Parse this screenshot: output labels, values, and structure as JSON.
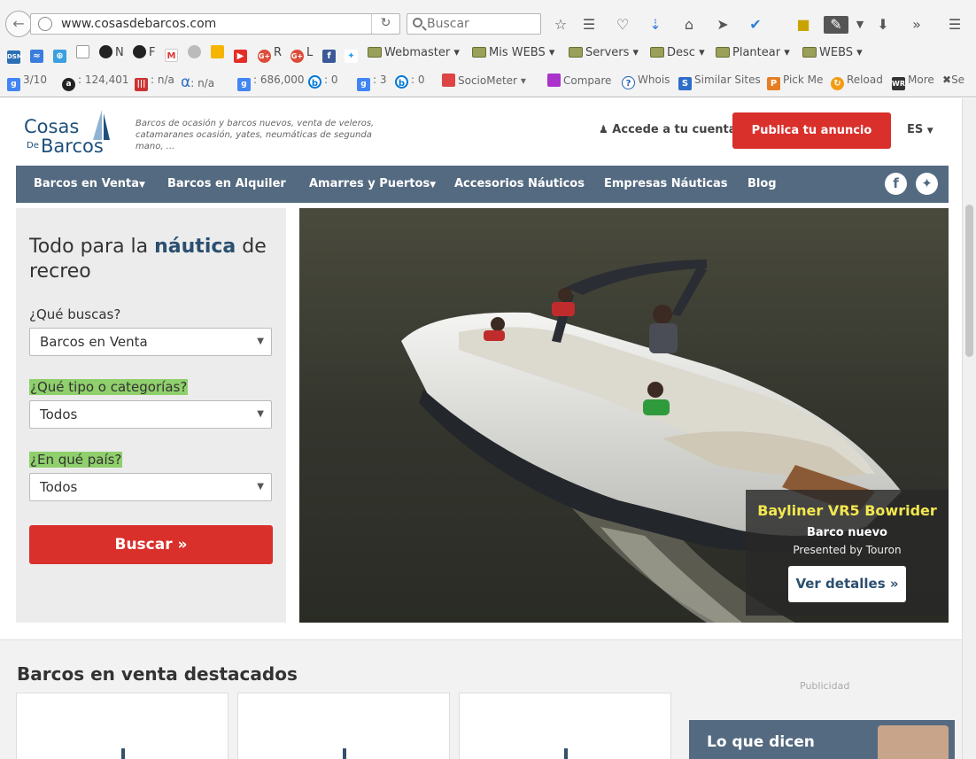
{
  "browser": {
    "url": "www.cosasdebarcos.com",
    "search_placeholder": "Buscar",
    "bookmarks": [
      {
        "label": "N",
        "type": "site"
      },
      {
        "label": "F",
        "type": "site"
      },
      {
        "label": "R",
        "type": "site"
      },
      {
        "label": "L",
        "type": "site"
      },
      {
        "label": "Webmaster",
        "type": "folder"
      },
      {
        "label": "Mis WEBS",
        "type": "folder"
      },
      {
        "label": "Servers",
        "type": "folder"
      },
      {
        "label": "Desc",
        "type": "folder"
      },
      {
        "label": "Plantear",
        "type": "folder"
      },
      {
        "label": "WEBS",
        "type": "folder"
      }
    ],
    "seo_stats": {
      "pagerank": "3/10",
      "alexa": "124,401",
      "stat3": "n/a",
      "stat4": "n/a",
      "indexed": "686,000",
      "bing1": "0",
      "stat7": "3",
      "bing2": "0",
      "sociometer": "SocioMeter",
      "compare": "Compare",
      "whois": "Whois",
      "similar": "Similar Sites",
      "pickme": "Pick Me",
      "reload": "Reload",
      "more": "More",
      "se": "Se"
    }
  },
  "header": {
    "logo_line1": "Cosas",
    "logo_de": "De",
    "logo_line2": "Barcos",
    "tagline": "Barcos de ocasión y barcos nuevos, venta de veleros, catamaranes ocasión, yates, neumáticas de segunda mano, ...",
    "account": "Accede a tu cuenta",
    "publish": "Publica tu anuncio",
    "lang": "ES"
  },
  "nav": [
    {
      "label": "Barcos en Venta",
      "dropdown": true
    },
    {
      "label": "Barcos en Alquiler",
      "dropdown": false
    },
    {
      "label": "Amarres y Puertos",
      "dropdown": true
    },
    {
      "label": "Accesorios Náuticos",
      "dropdown": false
    },
    {
      "label": "Empresas Náuticas",
      "dropdown": false
    },
    {
      "label": "Blog",
      "dropdown": false
    }
  ],
  "search": {
    "title_a": "Todo para la ",
    "title_b": "náutica",
    "title_c": " de recreo",
    "q1_label": "¿Qué buscas?",
    "q1_value": "Barcos en Venta",
    "q2_label": "¿Qué tipo o categorías?",
    "q2_value": "Todos",
    "q3_label": "¿En qué país?",
    "q3_value": "Todos",
    "button": "Buscar »"
  },
  "hero": {
    "boat_name": "Bayliner VR5 Bowrider",
    "boat_type": "Barco nuevo",
    "presented_by": "Presented by Touron",
    "cta": "Ver detalles »"
  },
  "featured": {
    "title": "Barcos en venta destacados",
    "ad_label": "Publicidad",
    "testimonial_title": "Lo que dicen"
  }
}
